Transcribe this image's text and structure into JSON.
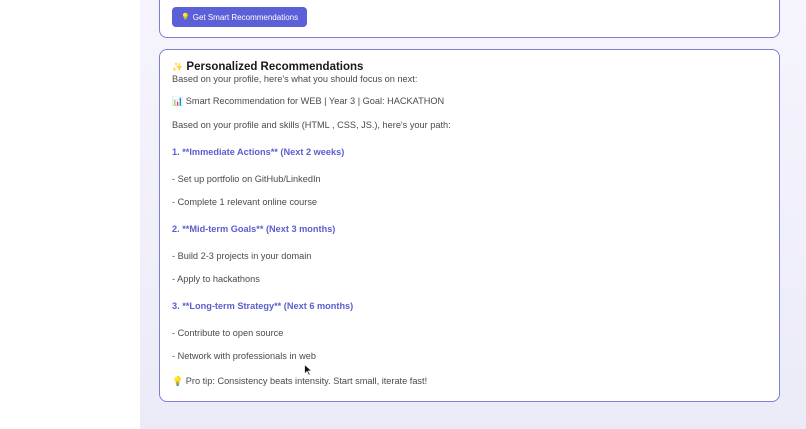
{
  "button": {
    "icon": "lightbulb-icon",
    "label": "Get Smart Recommendations"
  },
  "rec": {
    "title_icon": "✨",
    "title": "Personalized Recommendations",
    "subtitle": "Based on your profile, here's what you should focus on next:",
    "summary_icon": "📊",
    "summary": "Smart Recommendation for WEB | Year 3 | Goal: HACKATHON",
    "intro": "Based on your profile and skills (HTML , CSS, JS.), here's your path:",
    "section1": "1. **Immediate Actions** (Next 2 weeks)",
    "s1_item1": "- Set up portfolio on GitHub/LinkedIn",
    "s1_item2": "- Complete 1 relevant online course",
    "section2": "2. **Mid-term Goals** (Next 3 months)",
    "s2_item1": "- Build 2-3 projects in your domain",
    "s2_item2": "- Apply to hackathons",
    "section3": "3. **Long-term Strategy** (Next 6 months)",
    "s3_item1": "- Contribute to open source",
    "s3_item2": "- Network with professionals in web",
    "tip_icon": "💡",
    "tip": "Pro tip: Consistency beats intensity. Start small, iterate fast!"
  },
  "colors": {
    "accent": "#5b5fd8",
    "heading": "#5a5fcc",
    "border": "#7b7fd6"
  }
}
